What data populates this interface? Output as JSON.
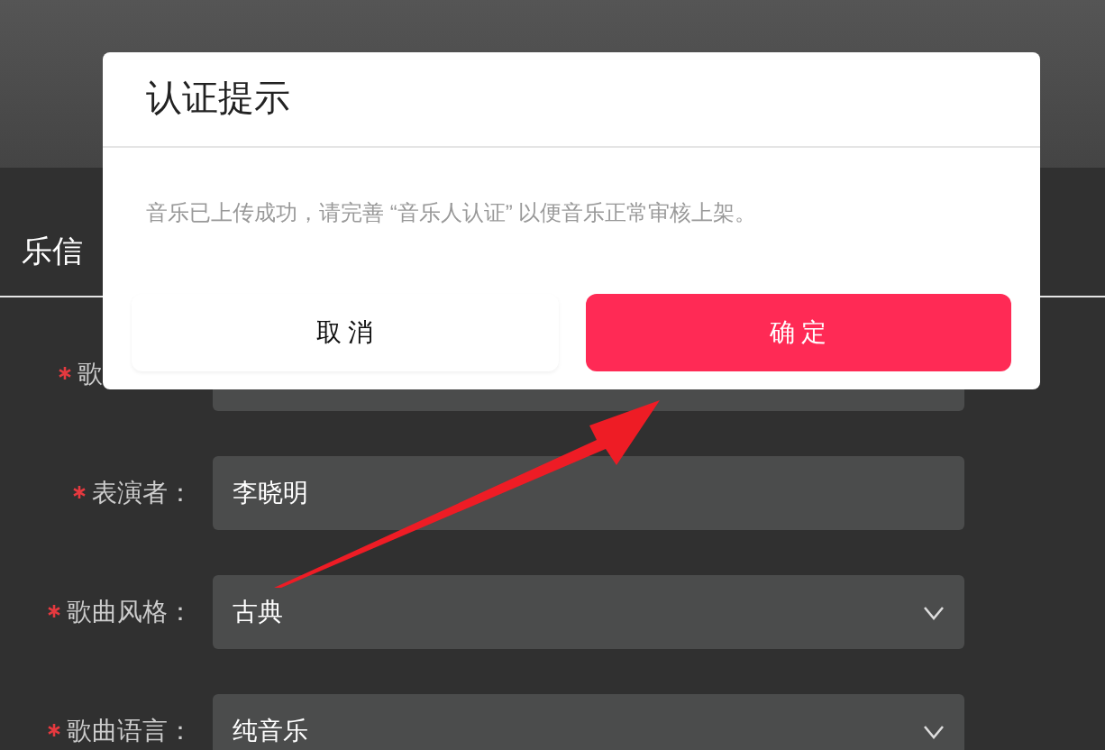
{
  "section_title": "乐信",
  "fields": [
    {
      "label": "歌",
      "required": true,
      "kind": "input",
      "covered": true
    },
    {
      "label": "表演者：",
      "required": true,
      "kind": "input",
      "covered": false,
      "value": "李晓明"
    },
    {
      "label": "歌曲风格：",
      "required": true,
      "kind": "select",
      "covered": false,
      "value": "古典"
    },
    {
      "label": "歌曲语言：",
      "required": true,
      "kind": "select",
      "covered": false,
      "value": "纯音乐"
    }
  ],
  "dialog": {
    "title": "认证提示",
    "message": "音乐已上传成功，请完善 “音乐人认证” 以便音乐正常审核上架。",
    "buttons": [
      {
        "label": "取 消",
        "kind": "secondary"
      },
      {
        "label": "确 定",
        "kind": "primary"
      }
    ]
  }
}
